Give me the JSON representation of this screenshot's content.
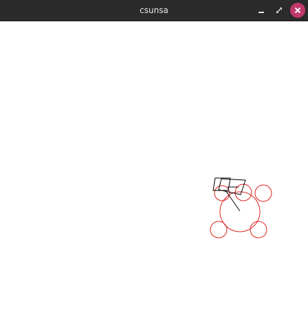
{
  "window": {
    "title": "csunsa",
    "controls": {
      "minimize_icon": "minimize-icon",
      "maximize_icon": "maximize-icon",
      "close_icon": "close-icon"
    }
  },
  "colors": {
    "titlebar_bg": "#2b2b2b",
    "title_text": "#e6e6e6",
    "close_button_bg": "#c1386a",
    "canvas_bg": "#ffffff",
    "shape_red": "#e0201f",
    "shape_black": "#000000"
  },
  "drawing": {
    "shapes": [
      "red-circle",
      "red-circle",
      "red-circle",
      "red-circle",
      "red-circle",
      "red-circle",
      "black-quadrilateral",
      "black-quadrilateral",
      "black-line",
      "black-line"
    ]
  }
}
